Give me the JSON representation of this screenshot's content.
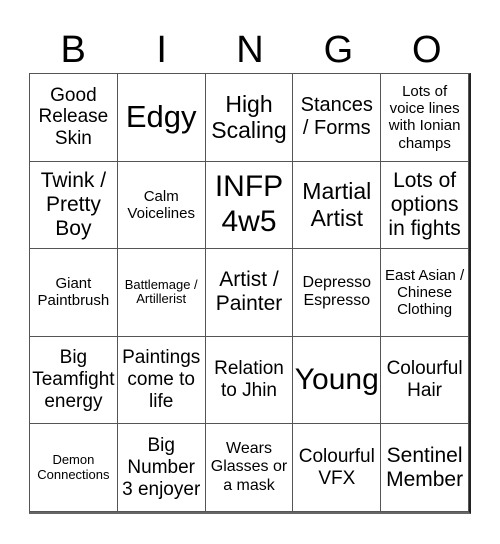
{
  "header": {
    "letters": [
      "B",
      "I",
      "N",
      "G",
      "O"
    ]
  },
  "grid": {
    "rows": [
      [
        "Good Release Skin",
        "Edgy",
        "High Scaling",
        "Stances / Forms",
        "Lots of voice lines with Ionian champs"
      ],
      [
        "Twink / Pretty Boy",
        "Calm Voicelines",
        "INFP 4w5",
        "Martial Artist",
        "Lots of options in fights"
      ],
      [
        "Giant Paintbrush",
        "Battlemage / Artillerist",
        "Artist / Painter",
        "Depresso Espresso",
        "East Asian / Chinese Clothing"
      ],
      [
        "Big Teamfight energy",
        "Paintings come to life",
        "Relation to Jhin",
        "Young",
        "Colourful Hair"
      ],
      [
        "Demon Connections",
        "Big Number 3 enjoyer",
        "Wears Glasses or a mask",
        "Colourful VFX",
        "Sentinel Member"
      ]
    ]
  }
}
